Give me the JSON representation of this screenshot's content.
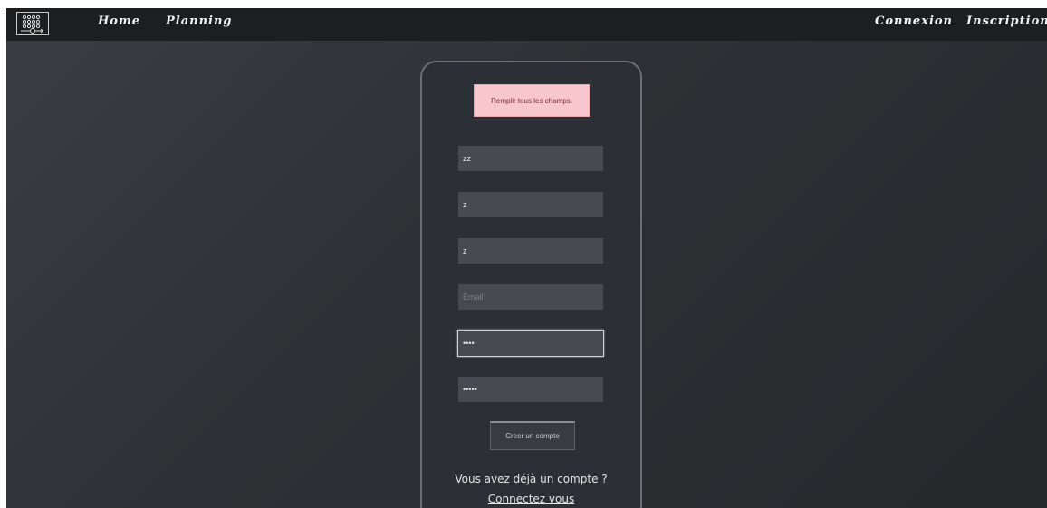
{
  "nav": {
    "home": "Home",
    "planning": "Planning",
    "connexion": "Connexion",
    "inscription": "Inscription"
  },
  "form": {
    "alert": "Remplir tous les champs.",
    "fields": [
      {
        "value": "zz",
        "placeholder": ""
      },
      {
        "value": "z",
        "placeholder": ""
      },
      {
        "value": "z",
        "placeholder": ""
      },
      {
        "value": "",
        "placeholder": "Email"
      },
      {
        "value": "••••",
        "placeholder": ""
      },
      {
        "value": "•••••",
        "placeholder": ""
      }
    ],
    "submit_label": "Creer un compte",
    "already_text": "Vous avez déjà un compte ?",
    "login_link": "Connectez vous"
  },
  "colors": {
    "alert_bg": "#f7c7cd",
    "navbar_bg": "#1d1e20",
    "card_bg": "#2c2f35",
    "field_bg": "#474a51"
  },
  "icons": {
    "logo": "schedule-grid-icon"
  }
}
